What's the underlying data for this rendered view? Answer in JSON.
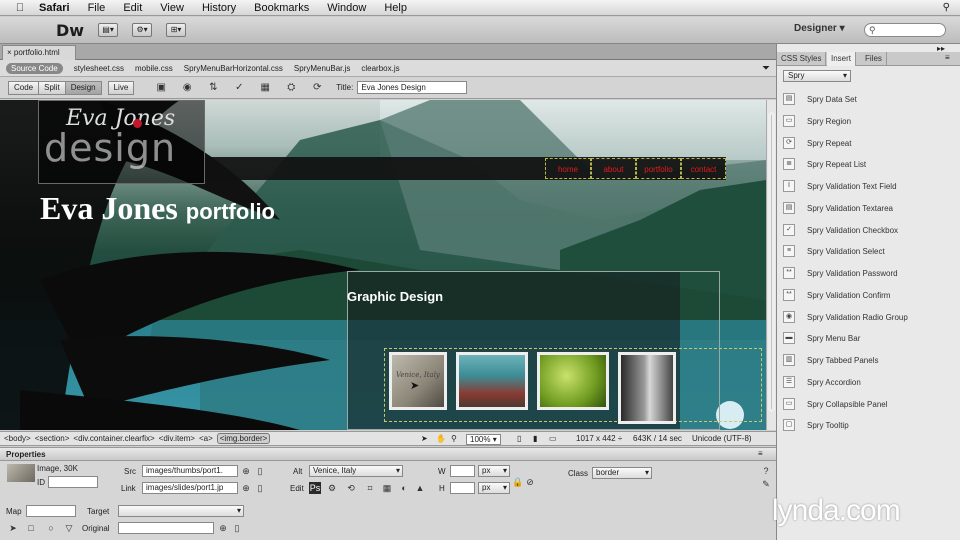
{
  "menubar": {
    "app": "Safari",
    "items": [
      "File",
      "Edit",
      "View",
      "History",
      "Bookmarks",
      "Window",
      "Help"
    ]
  },
  "appbar": {
    "logo": "Dw",
    "workspace": "Designer",
    "workspace_arrow": "▾"
  },
  "doc_tab": "portfolio.html",
  "related_files": [
    "Source Code",
    "stylesheet.css",
    "mobile.css",
    "SpryMenuBarHorizontal.css",
    "SpryMenuBar.js",
    "clearbox.js"
  ],
  "view_buttons": [
    "Code",
    "Split",
    "Design",
    "Live"
  ],
  "title_label": "Title:",
  "title_value": "Eva Jones Design",
  "page": {
    "logo_script": "Eva Jones",
    "logo_word": "design",
    "nav": [
      "home",
      "about",
      "portfolio",
      "contact"
    ],
    "heading_main": "Eva Jones",
    "heading_sub": "portfolio",
    "section_title": "Graphic Design",
    "thumb_caption": "Venice, Italy"
  },
  "tagbar": {
    "tags": [
      "<body>",
      "<section>",
      "<div.container.clearfix>",
      "<div.item>",
      "<a>",
      "<img.border>"
    ],
    "zoom": "100%",
    "size": "1017 x 442 ÷",
    "download": "643K / 14 sec",
    "encoding": "Unicode (UTF-8)"
  },
  "properties": {
    "header": "Properties",
    "type": "Image, 30K",
    "id_label": "ID",
    "src_label": "Src",
    "src_value": "images/thumbs/port1.",
    "link_label": "Link",
    "link_value": "images/slides/port1.jp",
    "alt_label": "Alt",
    "alt_value": "Venice, Italy",
    "edit_label": "Edit",
    "w_label": "W",
    "h_label": "H",
    "unit": "px",
    "class_label": "Class",
    "class_value": "border",
    "map_label": "Map",
    "target_label": "Target",
    "original_label": "Original"
  },
  "panel": {
    "tabs": [
      "CSS Styles",
      "Insert",
      "Files"
    ],
    "category": "Spry",
    "items": [
      "Spry Data Set",
      "Spry Region",
      "Spry Repeat",
      "Spry Repeat List",
      "Spry Validation Text Field",
      "Spry Validation Textarea",
      "Spry Validation Checkbox",
      "Spry Validation Select",
      "Spry Validation Password",
      "Spry Validation Confirm",
      "Spry Validation Radio Group",
      "Spry Menu Bar",
      "Spry Tabbed Panels",
      "Spry Accordion",
      "Spry Collapsible Panel",
      "Spry Tooltip"
    ]
  },
  "watermark": "lynda.com",
  "colors": {
    "nav_text": "#e01b1b",
    "nav_border": "#b9b64a",
    "selection_dash": "#c7c96a"
  }
}
